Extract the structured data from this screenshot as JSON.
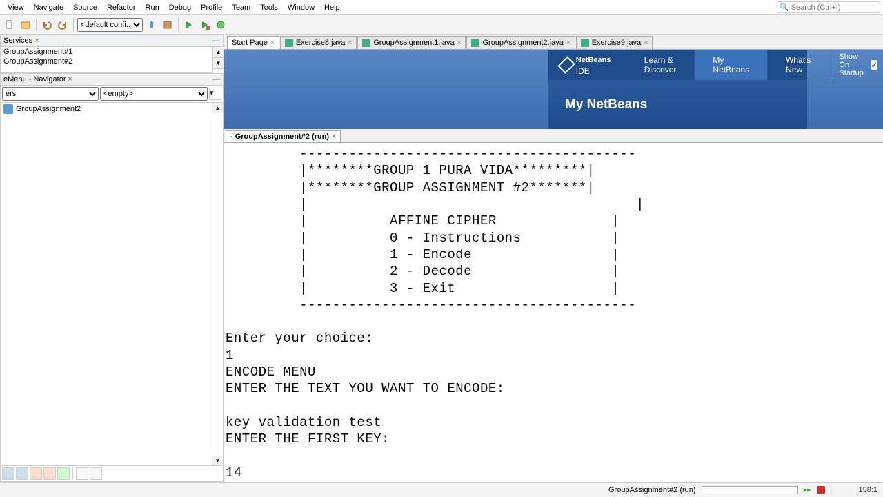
{
  "menubar": [
    "View",
    "Navigate",
    "Source",
    "Refactor",
    "Run",
    "Debug",
    "Profile",
    "Team",
    "Tools",
    "Window",
    "Help"
  ],
  "search_placeholder": "Search (Ctrl+I)",
  "toolbar": {
    "config_select": "<default confi..."
  },
  "panels": {
    "services_title": "Services",
    "navigator_title": "eMenu - Navigator",
    "projects": [
      "GroupAssignment#1",
      "GroupAssignment#2"
    ],
    "nav_scope": "ers",
    "nav_filter": "<empty>",
    "nav_item": "GroupAssignment2"
  },
  "editor_tabs": [
    {
      "label": "Start Page",
      "icon": false
    },
    {
      "label": "Exercise8.java",
      "icon": true
    },
    {
      "label": "GroupAssignment1.java",
      "icon": true
    },
    {
      "label": "GroupAssignment2.java",
      "icon": true
    },
    {
      "label": "Exercise9.java",
      "icon": true
    }
  ],
  "startpage": {
    "logo_text": "NetBeans",
    "logo_suffix": "IDE",
    "nav": [
      "Learn & Discover",
      "My NetBeans",
      "What's New"
    ],
    "active_nav": 1,
    "startup_label": "Show On Startup",
    "startup_checked": true,
    "banner_title": "My NetBeans"
  },
  "output_tab": "- GroupAssignment#2 (run)",
  "console_text": "         -----------------------------------------\n         |********GROUP 1 PURA VIDA*********|\n         |********GROUP ASSIGNMENT #2*******|\n         |                                        |\n         |          AFFINE CIPHER              |\n         |          0 - Instructions           |\n         |          1 - Encode                 |\n         |          2 - Decode                 |\n         |          3 - Exit                   |\n         -----------------------------------------\n\nEnter your choice:\n1\nENCODE MENU\nENTER THE TEXT YOU WANT TO ENCODE:\n\nkey validation test\nENTER THE FIRST KEY:\n\n14",
  "statusbar": {
    "run_label": "GroupAssignment#2 (run)",
    "running_icon": true,
    "cursor": "158:1"
  }
}
